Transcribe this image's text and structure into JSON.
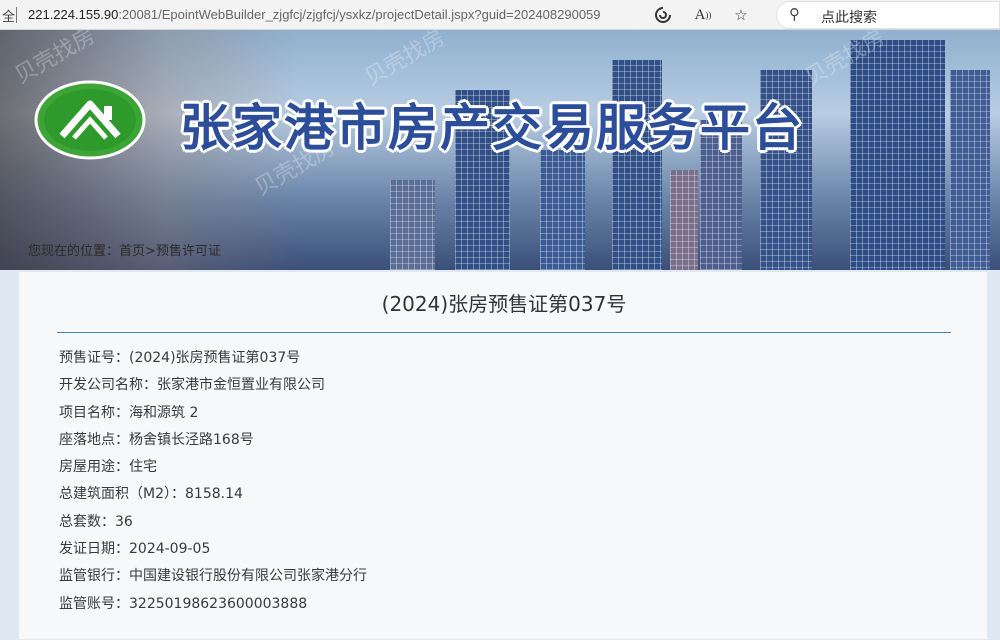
{
  "browser": {
    "lock_text": "全",
    "url_host": "221.224.155.90",
    "url_path": ":20081/EpointWebBuilder_zjgfcj/zjgfcj/ysxkz/projectDetail.jspx?guid=202408290059",
    "read_aloud_label": "A",
    "search_placeholder": "点此搜索"
  },
  "header": {
    "site_title": "张家港市房产交易服务平台",
    "breadcrumb_prefix": "您现在的位置：",
    "breadcrumb_home": "首页",
    "breadcrumb_sep": ">",
    "breadcrumb_current": "预售许可证",
    "watermark_text": "贝壳找房"
  },
  "document": {
    "title": "(2024)张房预售证第037号",
    "fields": [
      {
        "label": "预售证号：",
        "value": "(2024)张房预售证第037号"
      },
      {
        "label": "开发公司名称：",
        "value": "张家港市金恒置业有限公司"
      },
      {
        "label": "项目名称：",
        "value": "海和源筑 2"
      },
      {
        "label": "座落地点：",
        "value": "杨舍镇长泾路168号"
      },
      {
        "label": "房屋用途：",
        "value": "住宅"
      },
      {
        "label": "总建筑面积（M2）：",
        "value": "8158.14"
      },
      {
        "label": "总套数：",
        "value": "36"
      },
      {
        "label": "发证日期：",
        "value": "2024-09-05"
      },
      {
        "label": "监管银行：",
        "value": "中国建设银行股份有限公司张家港分行"
      },
      {
        "label": "监管账号：",
        "value": "32250198623600003888"
      }
    ]
  },
  "colors": {
    "title_blue": "#2b4d9a",
    "rule_teal": "#3d8ba6",
    "logo_green": "#3ea437"
  }
}
